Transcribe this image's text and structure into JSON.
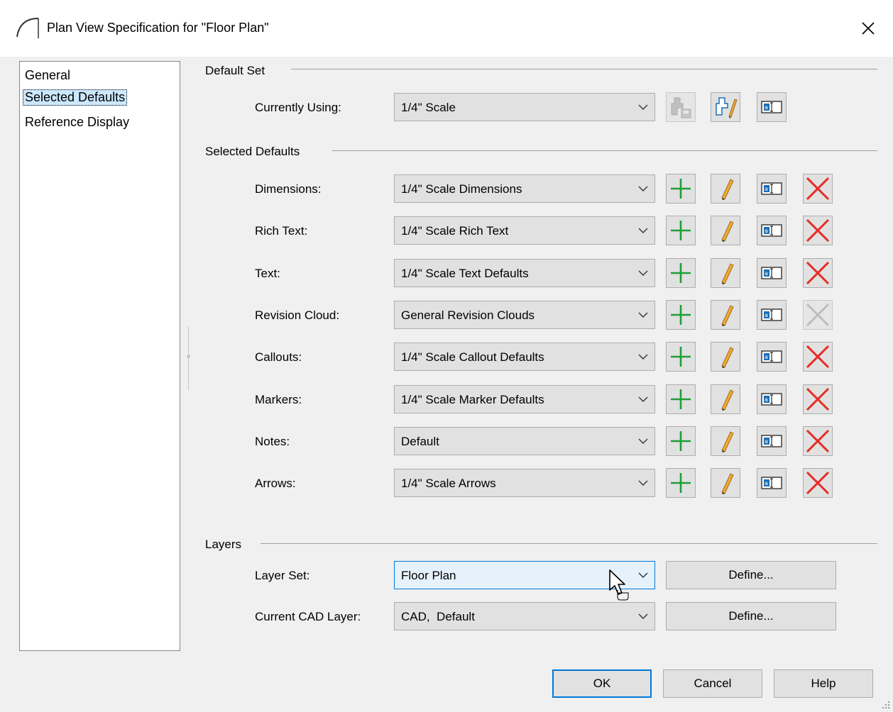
{
  "window": {
    "title": "Plan View Specification for \"Floor Plan\""
  },
  "nav": {
    "items": [
      {
        "label": "General"
      },
      {
        "label": "Selected Defaults"
      },
      {
        "label": "Reference Display"
      }
    ],
    "selected_index": 1
  },
  "default_set": {
    "group_label": "Default Set",
    "currently_using_label": "Currently Using:",
    "currently_using_value": "1/4\" Scale",
    "buttons": [
      "save-set-icon",
      "edit-set-icon",
      "rename-icon"
    ]
  },
  "selected_defaults": {
    "group_label": "Selected Defaults",
    "rows": [
      {
        "label": "Dimensions:",
        "value": "1/4\" Scale Dimensions",
        "delete_enabled": true
      },
      {
        "label": "Rich Text:",
        "value": "1/4\" Scale Rich Text",
        "delete_enabled": true
      },
      {
        "label": "Text:",
        "value": "1/4\" Scale Text Defaults",
        "delete_enabled": true
      },
      {
        "label": "Revision Cloud:",
        "value": "General Revision Clouds",
        "delete_enabled": false
      },
      {
        "label": "Callouts:",
        "value": "1/4\" Scale Callout Defaults",
        "delete_enabled": true
      },
      {
        "label": "Markers:",
        "value": "1/4\" Scale Marker Defaults",
        "delete_enabled": true
      },
      {
        "label": "Notes:",
        "value": "Default",
        "delete_enabled": true
      },
      {
        "label": "Arrows:",
        "value": "1/4\" Scale Arrows",
        "delete_enabled": true
      }
    ]
  },
  "layers": {
    "group_label": "Layers",
    "layer_set_label": "Layer Set:",
    "layer_set_value": "Floor Plan",
    "cad_layer_label": "Current CAD Layer:",
    "cad_layer_value": "CAD,  Default",
    "define_label": "Define..."
  },
  "footer": {
    "ok": "OK",
    "cancel": "Cancel",
    "help": "Help"
  },
  "colors": {
    "accent": "#0078d7",
    "add_green": "#1f9e3a",
    "delete_red": "#e52d27",
    "pencil": "#f0a830",
    "selection": "#cce8ff"
  }
}
